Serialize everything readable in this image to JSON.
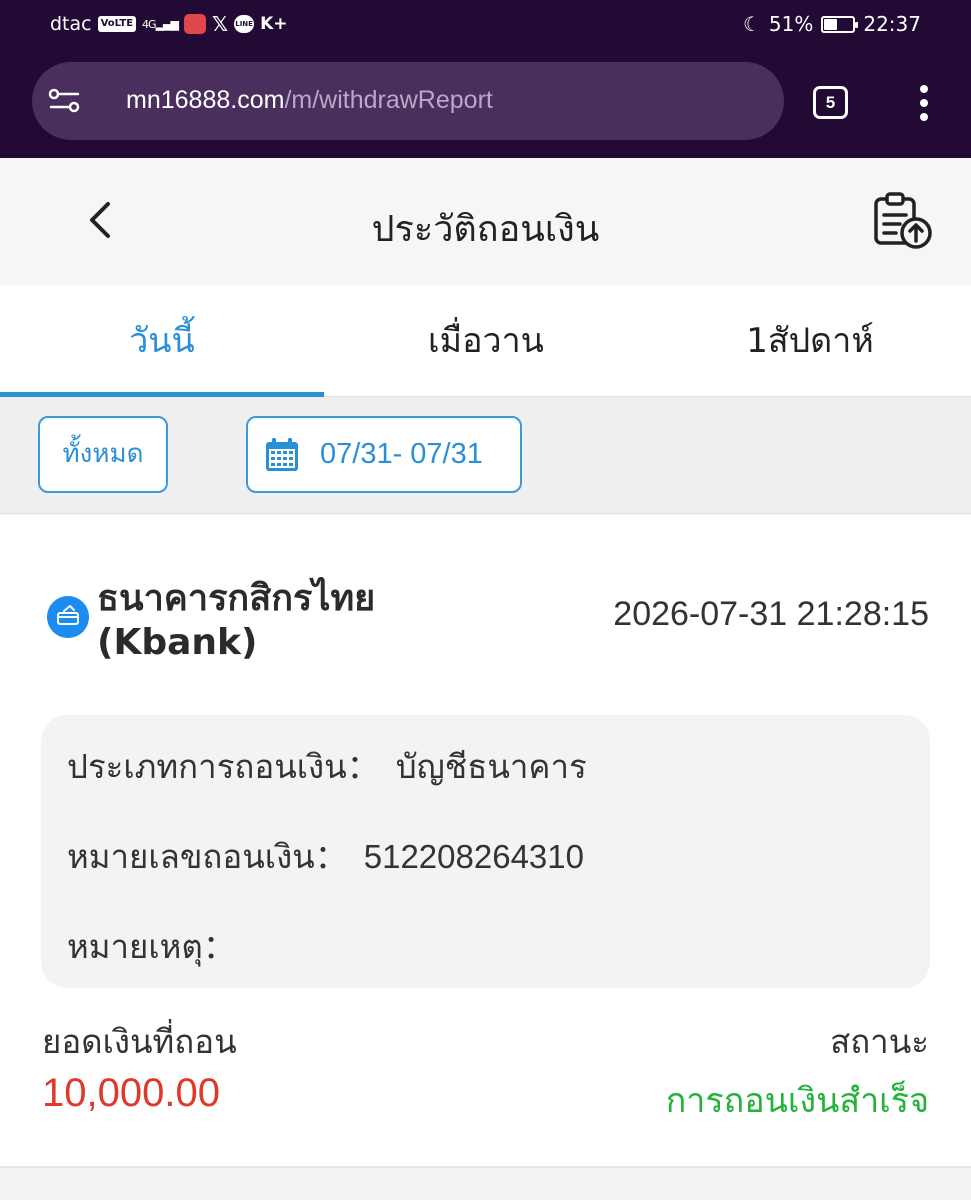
{
  "status_bar": {
    "carrier": "dtac",
    "volte_badge": "VoLTE",
    "network": "4G",
    "app_icons": [
      "shopee-icon",
      "x-icon",
      "line-icon",
      "kplus-icon"
    ],
    "kplus_label": "K+",
    "line_label": "LINE",
    "battery_percent": "51%",
    "battery_level": 0.51,
    "time": "22:37"
  },
  "browser": {
    "url_domain": "mn16888.com",
    "url_path": "/m/withdrawReport",
    "tab_count": "5"
  },
  "header": {
    "title": "ประวัติถอนเงิน"
  },
  "tabs": [
    {
      "label": "วันนี้",
      "active": true
    },
    {
      "label": "เมื่อวาน",
      "active": false
    },
    {
      "label": "1สัปดาห์",
      "active": false
    }
  ],
  "filters": {
    "all_label": "ทั้งหมด",
    "date_range": "07/31- 07/31"
  },
  "record": {
    "bank_name": "ธนาคารกสิกรไทย (Kbank)",
    "datetime": "2026-07-31 21:28:15",
    "details": {
      "type_label": "ประเภทการถอนเงิน：",
      "type_value": "บัญชีธนาคาร",
      "number_label": "หมายเลขถอนเงิน：",
      "number_value": "512208264310",
      "note_label": "หมายเหตุ：",
      "note_value": ""
    },
    "amount_label": "ยอดเงินที่ถอน",
    "amount_value": "10,000.00",
    "status_label": "สถานะ",
    "status_value": "การถอนเงินสำเร็จ"
  },
  "colors": {
    "browser_bg": "#220a35",
    "accent": "#2a8fd6",
    "amount": "#e0382a",
    "success": "#22b338"
  }
}
